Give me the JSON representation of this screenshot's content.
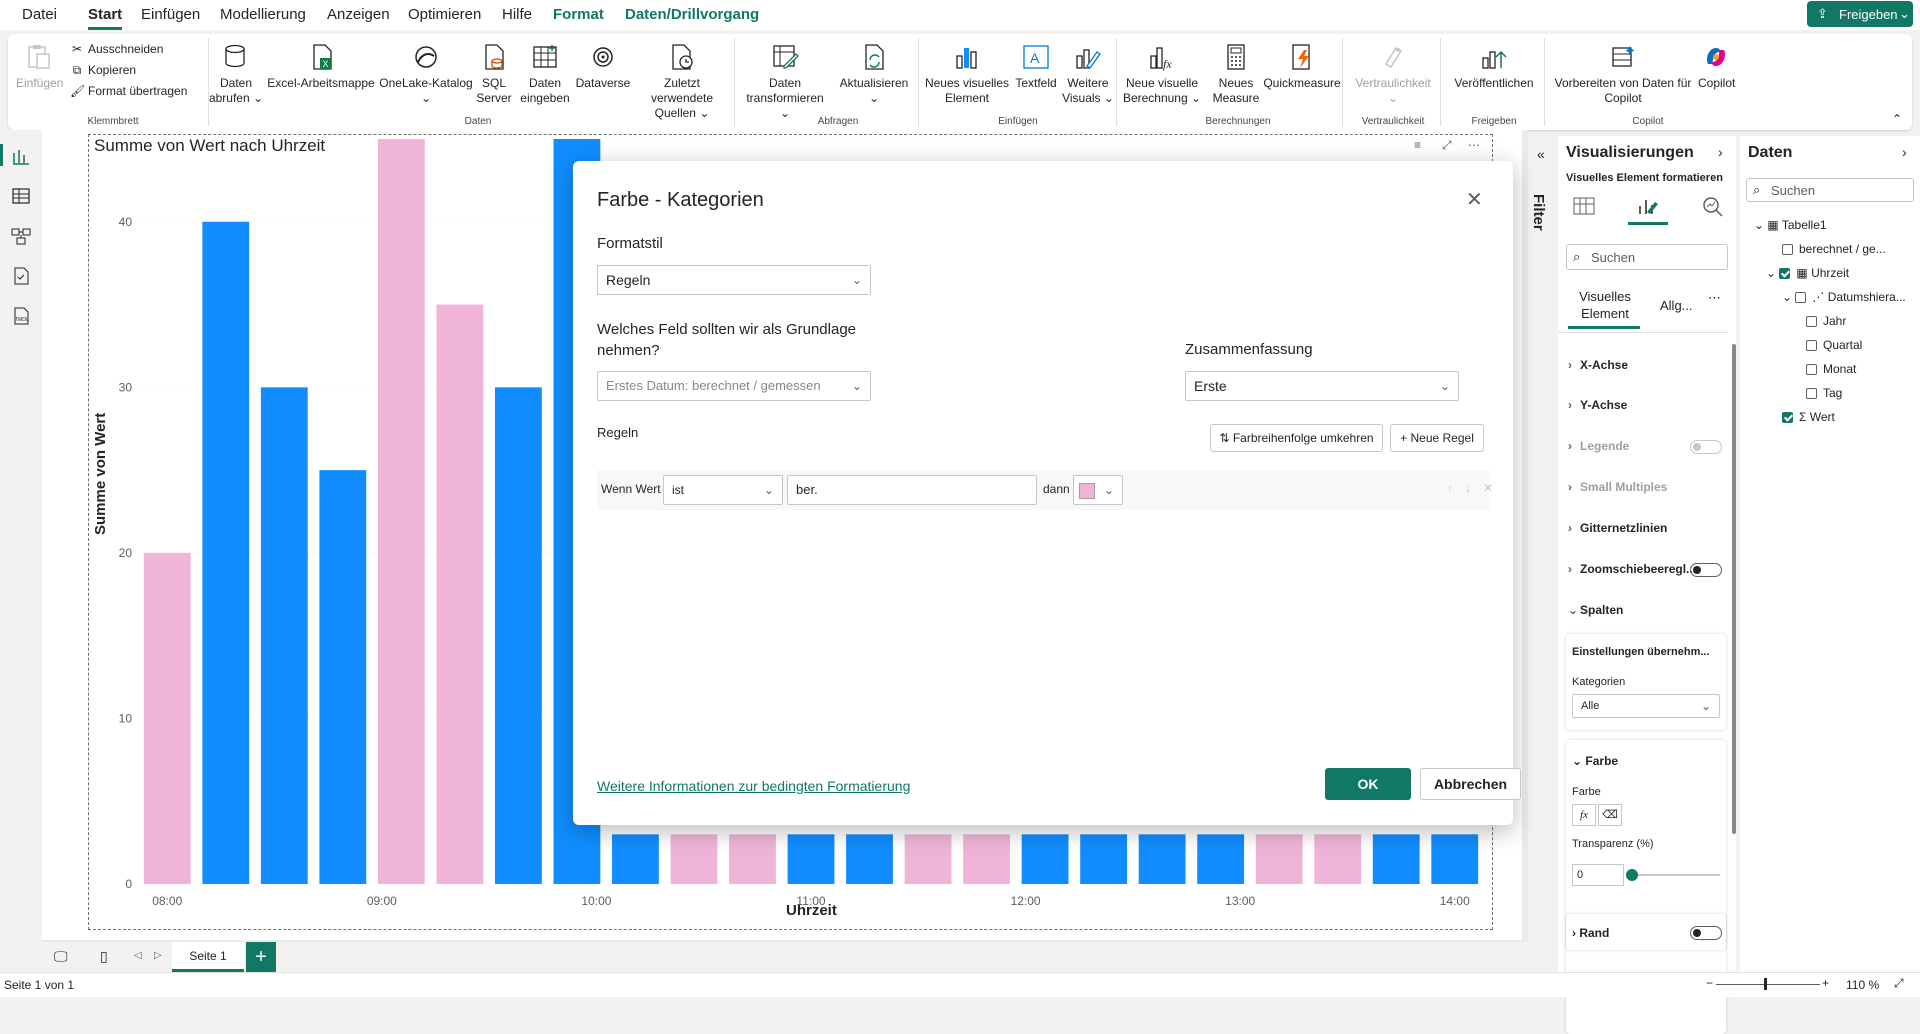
{
  "menu": {
    "items": [
      "Datei",
      "Start",
      "Einfügen",
      "Modellierung",
      "Anzeigen",
      "Optimieren",
      "Hilfe",
      "Format",
      "Daten/Drillvorgang"
    ],
    "share_label": "Freigeben"
  },
  "ribbon": {
    "clipboard": {
      "paste": "Einfügen",
      "cut": "Ausschneiden",
      "copy": "Kopieren",
      "format_painter": "Format übertragen",
      "group": "Klemmbrett"
    },
    "data": {
      "get_data": "Daten abrufen",
      "excel": "Excel-Arbeitsmappe",
      "onelake": "OneLake-Katalog",
      "sql": "SQL Server",
      "enter_data": "Daten eingeben",
      "dataverse": "Dataverse",
      "recent": "Zuletzt verwendete Quellen",
      "group": "Daten"
    },
    "queries": {
      "transform": "Daten transformieren",
      "refresh": "Aktualisieren",
      "group": "Abfragen"
    },
    "insert": {
      "new_visual": "Neues visuelles Element",
      "textbox": "Textfeld",
      "more_visuals": "Weitere Visuals",
      "group": "Einfügen"
    },
    "calculations": {
      "new_calc": "Neue visuelle Berechnung",
      "new_measure": "Neues Measure",
      "quick_measure": "Quickmeasure",
      "group": "Berechnungen"
    },
    "sensitivity": {
      "label": "Vertraulichkeit",
      "group": "Vertraulichkeit"
    },
    "share": {
      "publish": "Veröffentlichen",
      "group": "Freigeben"
    },
    "copilot": {
      "prepare": "Vorbereiten von Daten für Copilot",
      "copilot": "Copilot",
      "group": "Copilot"
    }
  },
  "chart_data": {
    "type": "bar",
    "title": "Summe von Wert nach Uhrzeit",
    "xlabel": "Uhrzeit",
    "ylabel": "Summe von Wert",
    "ylim": [
      0,
      45
    ],
    "yticks": [
      0,
      10,
      20,
      30,
      40
    ],
    "xticks": [
      "08:00",
      "09:00",
      "10:00",
      "11:00",
      "12:00",
      "13:00",
      "14:00"
    ],
    "colors": {
      "berechnet": "#f0b4d8",
      "gemessen": "#118dff"
    },
    "bars": [
      {
        "cat": "berechnet",
        "value": 20
      },
      {
        "cat": "gemessen",
        "value": 40
      },
      {
        "cat": "gemessen",
        "value": 30
      },
      {
        "cat": "gemessen",
        "value": 25
      },
      {
        "cat": "berechnet",
        "value": 45
      },
      {
        "cat": "berechnet",
        "value": 35
      },
      {
        "cat": "gemessen",
        "value": 30
      },
      {
        "cat": "gemessen",
        "value": 45
      },
      {
        "cat": "gemessen",
        "value": 3
      },
      {
        "cat": "berechnet",
        "value": 3
      },
      {
        "cat": "berechnet",
        "value": 3
      },
      {
        "cat": "gemessen",
        "value": 3
      },
      {
        "cat": "gemessen",
        "value": 3
      },
      {
        "cat": "berechnet",
        "value": 3
      },
      {
        "cat": "berechnet",
        "value": 3
      },
      {
        "cat": "gemessen",
        "value": 3
      },
      {
        "cat": "gemessen",
        "value": 3
      },
      {
        "cat": "gemessen",
        "value": 3
      },
      {
        "cat": "gemessen",
        "value": 3
      },
      {
        "cat": "berechnet",
        "value": 3
      },
      {
        "cat": "berechnet",
        "value": 3
      },
      {
        "cat": "gemessen",
        "value": 3
      },
      {
        "cat": "gemessen",
        "value": 3
      }
    ]
  },
  "dialog": {
    "title": "Farbe - Kategorien",
    "format_style_label": "Formatstil",
    "format_style_value": "Regeln",
    "field_question": "Welches Feld sollten wir als Grundlage nehmen?",
    "field_value": "Erstes Datum: berechnet / gemessen",
    "summary_label": "Zusammenfassung",
    "summary_value": "Erste",
    "rules_label": "Regeln",
    "reverse_label": "Farbreihenfolge umkehren",
    "new_rule_label": "Neue Regel",
    "rule_if": "Wenn Wert",
    "rule_op": "ist",
    "rule_value": "ber.",
    "rule_then": "dann",
    "rule_color": "#f0b4d8",
    "more_info_link": "Weitere Informationen zur bedingten Formatierung",
    "ok_label": "OK",
    "cancel_label": "Abbrechen"
  },
  "filter_label": "Filter",
  "viz_pane": {
    "title": "Visualisierungen",
    "subtitle": "Visuelles Element formatieren",
    "search_placeholder": "Suchen",
    "tab_visual": "Visuelles Element",
    "tab_general": "Allg...",
    "sections": [
      "X-Achse",
      "Y-Achse",
      "Legende",
      "Small Multiples",
      "Gitternetzlinien",
      "Zoomschiebeeregl...",
      "Spalten"
    ],
    "apply_settings": "Einstellungen übernehm...",
    "categories_label": "Kategorien",
    "categories_value": "Alle",
    "color_section": "Farbe",
    "color_label": "Farbe",
    "transparency_label": "Transparenz (%)",
    "transparency_value": "0",
    "border_label": "Rand"
  },
  "data_pane": {
    "title": "Daten",
    "search_placeholder": "Suchen",
    "table": "Tabelle1",
    "fields": [
      "berechnet / ge...",
      "Uhrzeit",
      "Datumshiera...",
      "Jahr",
      "Quartal",
      "Monat",
      "Tag",
      "Wert"
    ]
  },
  "pages": {
    "tab": "Seite 1"
  },
  "status": {
    "page": "Seite 1 von 1",
    "zoom": "110 %"
  }
}
